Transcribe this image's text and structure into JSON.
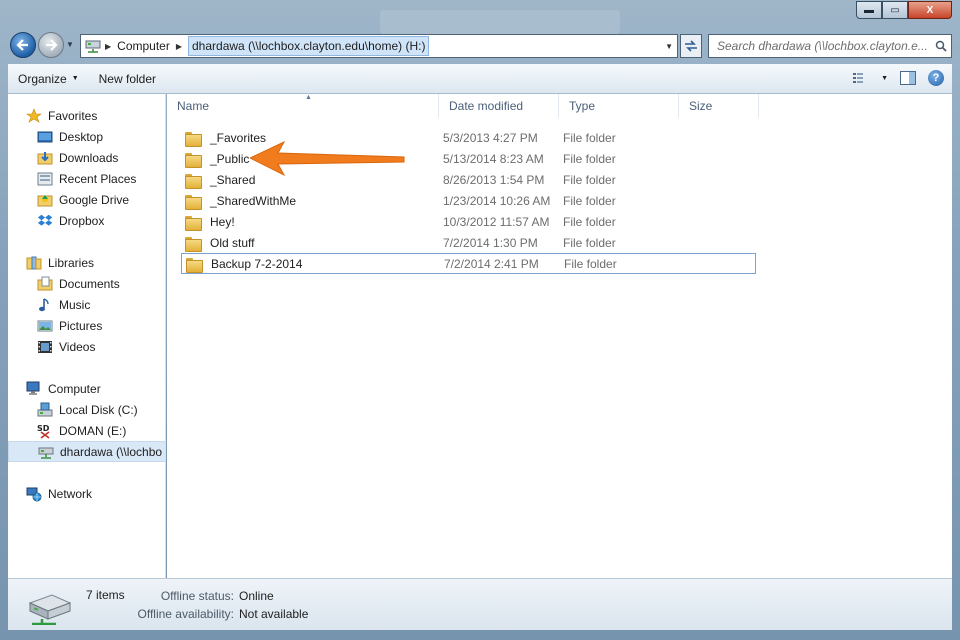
{
  "window": {
    "min_label": "▬",
    "max_label": "▭",
    "close_label": "X"
  },
  "address": {
    "root": "Computer",
    "path": "dhardawa (\\\\lochbox.clayton.edu\\home) (H:)"
  },
  "search": {
    "placeholder": "Search dhardawa (\\\\lochbox.clayton.e..."
  },
  "toolbar": {
    "organize_label": "Organize",
    "new_folder_label": "New folder",
    "help_label": "?"
  },
  "sidebar": {
    "favorites": {
      "label": "Favorites",
      "items": [
        {
          "label": "Desktop"
        },
        {
          "label": "Downloads"
        },
        {
          "label": "Recent Places"
        },
        {
          "label": "Google Drive"
        },
        {
          "label": "Dropbox"
        }
      ]
    },
    "libraries": {
      "label": "Libraries",
      "items": [
        {
          "label": "Documents"
        },
        {
          "label": "Music"
        },
        {
          "label": "Pictures"
        },
        {
          "label": "Videos"
        }
      ]
    },
    "computer": {
      "label": "Computer",
      "items": [
        {
          "label": "Local Disk (C:)"
        },
        {
          "label": "DOMAN (E:)"
        },
        {
          "label": "dhardawa (\\\\lochbo"
        }
      ]
    },
    "network": {
      "label": "Network"
    }
  },
  "columns": [
    "Name",
    "Date modified",
    "Type",
    "Size"
  ],
  "files": [
    {
      "name": "_Favorites",
      "date": "5/3/2013 4:27 PM",
      "type": "File folder"
    },
    {
      "name": "_Public",
      "date": "5/13/2014 8:23 AM",
      "type": "File folder"
    },
    {
      "name": "_Shared",
      "date": "8/26/2013 1:54 PM",
      "type": "File folder"
    },
    {
      "name": "_SharedWithMe",
      "date": "1/23/2014 10:26 AM",
      "type": "File folder"
    },
    {
      "name": "Hey!",
      "date": "10/3/2012 11:57 AM",
      "type": "File folder"
    },
    {
      "name": "Old stuff",
      "date": "7/2/2014 1:30 PM",
      "type": "File folder"
    },
    {
      "name": "Backup 7-2-2014",
      "date": "7/2/2014 2:41 PM",
      "type": "File folder"
    }
  ],
  "status": {
    "count": "7 items",
    "offline_status_label": "Offline status:",
    "offline_status_value": "Online",
    "offline_avail_label": "Offline availability:",
    "offline_avail_value": "Not available"
  },
  "colors": {
    "annotation_arrow": "#f07c1e",
    "selection_border": "#7da2ce"
  }
}
